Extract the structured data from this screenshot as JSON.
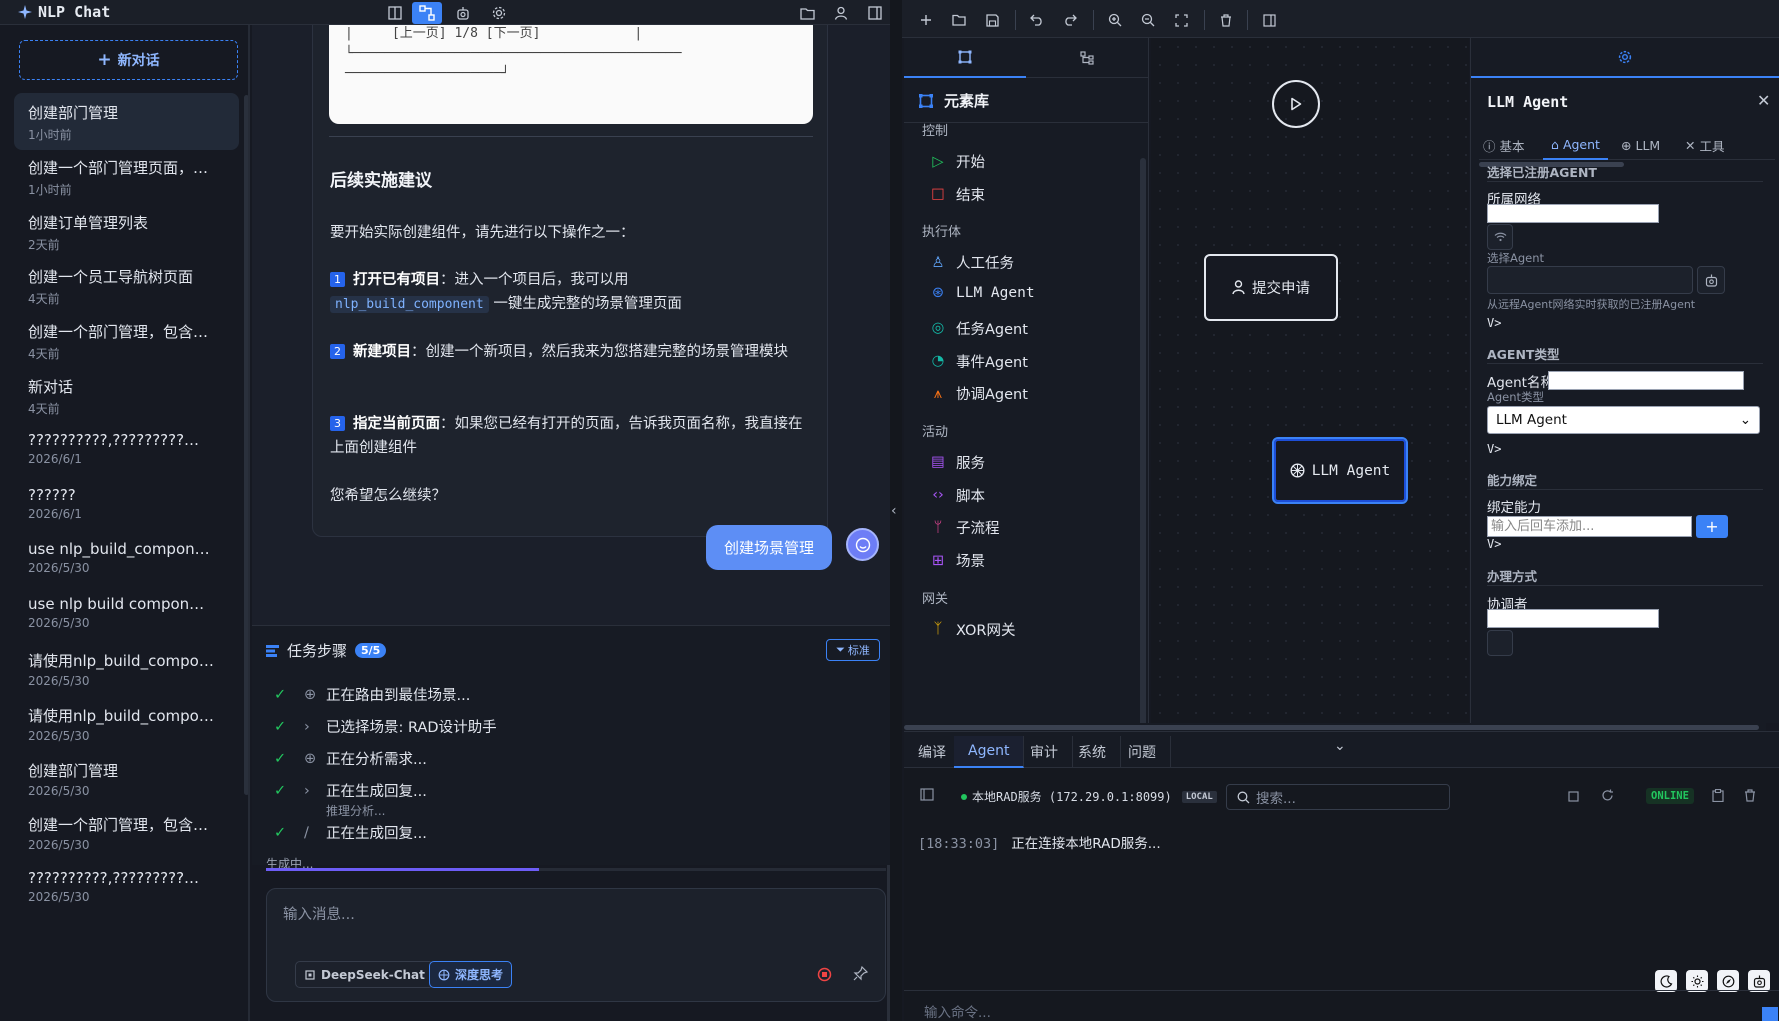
{
  "app": {
    "title": "NLP Chat"
  },
  "sidebar": {
    "new_chat": "新对话",
    "conversations": [
      {
        "title": "创建部门管理",
        "time": "1小时前"
      },
      {
        "title": "创建一个部门管理页面，…",
        "time": "1小时前"
      },
      {
        "title": "创建订单管理列表",
        "time": "2天前"
      },
      {
        "title": "创建一个员工导航树页面",
        "time": "4天前"
      },
      {
        "title": "创建一个部门管理，包含…",
        "time": "4天前"
      },
      {
        "title": "新对话",
        "time": "4天前"
      },
      {
        "title": "??????????,?????????…",
        "time": "2026/6/1"
      },
      {
        "title": "??????",
        "time": "2026/6/1"
      },
      {
        "title": "use nlp_build_compon…",
        "time": "2026/5/30"
      },
      {
        "title": "use nlp build compon…",
        "time": "2026/5/30"
      },
      {
        "title": "请使用nlp_build_compo…",
        "time": "2026/5/30"
      },
      {
        "title": "请使用nlp_build_compo…",
        "time": "2026/5/30"
      },
      {
        "title": "创建部门管理",
        "time": "2026/5/30"
      },
      {
        "title": "创建一个部门管理，包含…",
        "time": "2026/5/30"
      },
      {
        "title": "??????????,?????????…",
        "time": "2026/5/30"
      }
    ]
  },
  "chat": {
    "table_lines": [
      "|     [上一页] 1/8 [下一页]            |",
      "└──────────────────────────────────────────",
      "────────────────────┘"
    ],
    "heading": "后续实施建议",
    "intro": "要开始实际创建组件，请先进行以下操作之一：",
    "opt1_num": "1",
    "opt1_bold": "打开已有项目",
    "opt1_text": "：进入一个项目后，我可以用",
    "opt1_code": "nlp_build_component",
    "opt1_tail": "一键生成完整的场景管理页面",
    "opt2_num": "2",
    "opt2_bold": "新建项目",
    "opt2_text": "：创建一个新项目，然后我来为您搭建完整的场景管理模块",
    "opt3_num": "3",
    "opt3_bold": "指定当前页面",
    "opt3_text": "：如果您已经有打开的页面，告诉我页面名称，我直接在上面创建组件",
    "closing": "您希望怎么继续？",
    "user_message": "创建场景管理"
  },
  "tasks": {
    "title": "任务步骤",
    "badge": "5/5",
    "mode": "标准",
    "steps": [
      {
        "label": "正在路由到最佳场景..."
      },
      {
        "label": "已选择场景: RAD设计助手"
      },
      {
        "label": "正在分析需求..."
      },
      {
        "label": "正在生成回复...",
        "sub": "推理分析..."
      },
      {
        "label": "正在生成回复..."
      }
    ],
    "generating": "生成中...",
    "progress": 0.44
  },
  "composer": {
    "placeholder": "输入消息...",
    "model": "DeepSeek-Chat",
    "deep_think": "深度思考"
  },
  "library": {
    "title": "元素库",
    "groups": [
      {
        "name": "控制",
        "items": [
          "开始",
          "结束"
        ]
      },
      {
        "name": "执行体",
        "items": [
          "人工任务",
          "LLM Agent",
          "任务Agent",
          "事件Agent",
          "协调Agent"
        ]
      },
      {
        "name": "活动",
        "items": [
          "服务",
          "脚本",
          "子流程",
          "场景"
        ]
      },
      {
        "name": "网关",
        "items": [
          "XOR网关"
        ]
      }
    ]
  },
  "canvas": {
    "node_submit": "提交申请",
    "node_llm": "LLM Agent"
  },
  "props": {
    "title": "LLM Agent",
    "tabs": [
      "基本",
      "Agent",
      "LLM",
      "工具"
    ],
    "sec_registered": "选择已注册AGENT",
    "network_label": "所属网络",
    "select_agent_label": "选择Agent",
    "select_agent_hint": "从远程Agent网络实时获取的已注册Agent",
    "vgt": "V>",
    "sec_type": "AGENT类型",
    "agent_name_label": "Agent名称",
    "agent_type_label": "Agent类型",
    "agent_type_value": "LLM Agent",
    "sec_ability": "能力绑定",
    "bind_label": "绑定能力",
    "bind_placeholder": "输入后回车添加...",
    "sec_handle": "办理方式",
    "coordinator_label": "协调者"
  },
  "bottom": {
    "tabs": [
      "编译",
      "Agent",
      "审计",
      "系统",
      "问题"
    ],
    "service": "本地RAD服务 (172.29.0.1:8099)",
    "local": "LOCAL",
    "search_placeholder": "搜索...",
    "online": "ONLINE",
    "log_time": "[18:33:03]",
    "log_text": "正在连接本地RAD服务...",
    "command_placeholder": "输入命令..."
  },
  "colors": {
    "accent": "#3b82f6",
    "success": "#22c55e",
    "user_bubble": "#5d8ef5"
  }
}
